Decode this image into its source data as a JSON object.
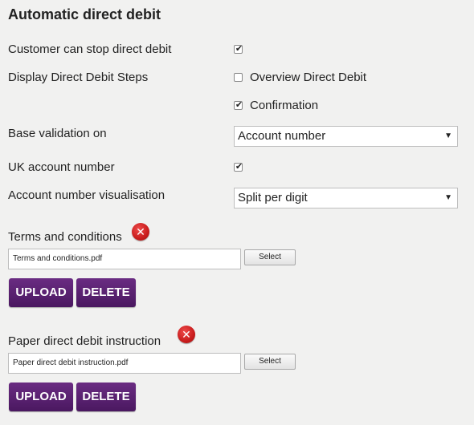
{
  "section": {
    "title": "Automatic direct debit"
  },
  "rows": {
    "customer_stop": {
      "label": "Customer can stop direct debit",
      "checked": true
    },
    "display_steps": {
      "label": "Display Direct Debit Steps"
    },
    "overview": {
      "label": "Overview Direct Debit",
      "checked": false
    },
    "confirmation": {
      "label": "Confirmation",
      "checked": true
    },
    "base_validation": {
      "label": "Base validation on",
      "value": "Account number"
    },
    "uk_account": {
      "label": "UK account number",
      "checked": true
    },
    "visualisation": {
      "label": "Account number visualisation",
      "value": "Split per digit"
    }
  },
  "checkmark": "✔",
  "dropdown_arrow": "▼",
  "error_icon": "✕",
  "terms": {
    "label": "Terms and conditions",
    "file": "Terms and conditions.pdf",
    "select_label": "Select",
    "upload_label": "UPLOAD",
    "delete_label": "DELETE"
  },
  "paper": {
    "label": "Paper direct debit instruction",
    "file": "Paper direct debit instruction.pdf",
    "select_label": "Select",
    "upload_label": "UPLOAD",
    "delete_label": "DELETE"
  },
  "colors": {
    "button": "#5a2271",
    "error": "#c91d1d",
    "background": "#f1f1f0"
  }
}
